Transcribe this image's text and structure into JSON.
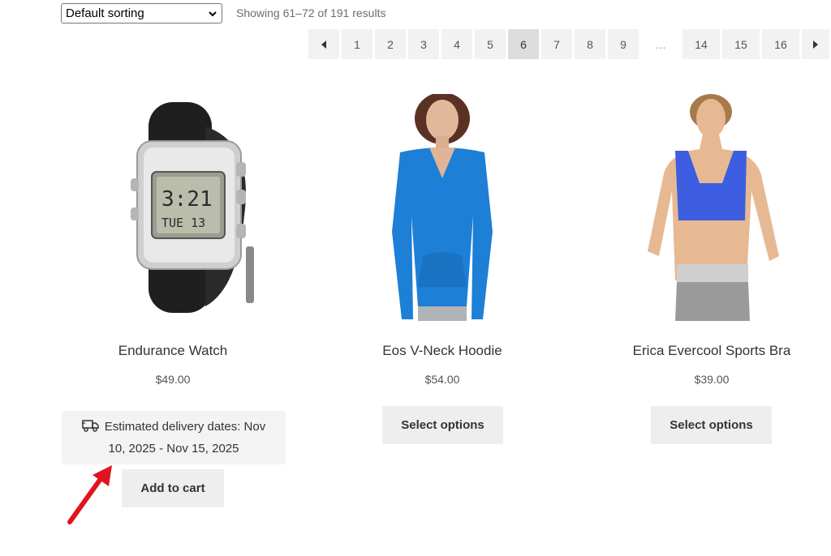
{
  "toolbar": {
    "sort_selected": "Default sorting",
    "result_count": "Showing 61–72 of 191 results"
  },
  "pagination": {
    "pages": [
      "1",
      "2",
      "3",
      "4",
      "5",
      "6",
      "7",
      "8",
      "9",
      "…",
      "14",
      "15",
      "16"
    ],
    "current": "6"
  },
  "products": [
    {
      "title": "Endurance Watch",
      "price": "$49.00",
      "button": "Add to cart"
    },
    {
      "title": "Eos V-Neck Hoodie",
      "price": "$54.00",
      "button": "Select options"
    },
    {
      "title": "Erica Evercool Sports Bra",
      "price": "$39.00",
      "button": "Select options"
    }
  ],
  "delivery": {
    "line1": "Estimated delivery dates: Nov",
    "line2": "10, 2025 - Nov 15, 2025"
  },
  "colors": {
    "arrow": "#e0141e",
    "hoodie": "#1d7fd6",
    "bra": "#3d5ee0"
  }
}
